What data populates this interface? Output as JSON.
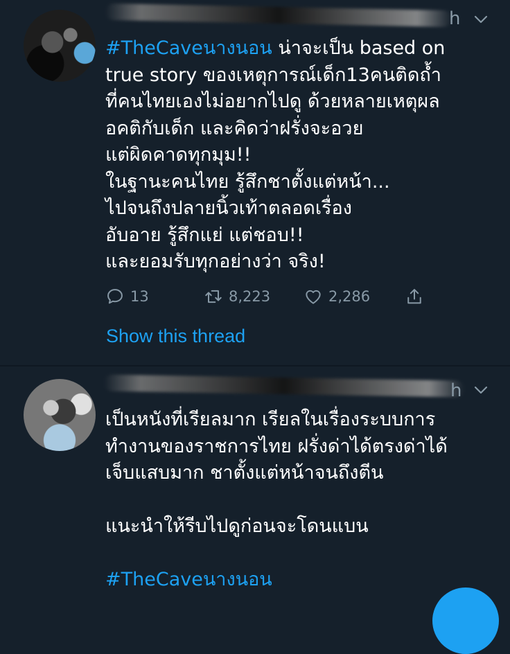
{
  "tweets": [
    {
      "time": "h",
      "lines": [
        {
          "hashtag": "#TheCaveนางนอน",
          "text": " น่าจะเป็น based on"
        },
        {
          "hashtag": "",
          "text": "true story ของเหตุการณ์เด็ก13คนติดถ้ำ"
        },
        {
          "hashtag": "",
          "text": "ที่คนไทยเองไม่อยากไปดู ด้วยหลายเหตุผล"
        },
        {
          "hashtag": "",
          "text": "อคติกับเด็ก และคิดว่าฝรั่งจะอวย"
        },
        {
          "hashtag": "",
          "text": "แต่ผิดคาดทุกมุม!!"
        },
        {
          "hashtag": "",
          "text": "ในฐานะคนไทย รู้สึกชาตั้งแต่หน้า..."
        },
        {
          "hashtag": "",
          "text": "ไปจนถึงปลายนิ้วเท้าตลอดเรื่อง"
        },
        {
          "hashtag": "",
          "text": "อับอาย รู้สึกแย่ แต่ชอบ!!"
        },
        {
          "hashtag": "",
          "text": "และยอมรับทุกอย่างว่า จริง!"
        }
      ],
      "replies": "13",
      "retweets": "8,223",
      "likes": "2,286",
      "show_thread": "Show this thread"
    },
    {
      "time": "h",
      "lines": [
        "เป็นหนังที่เรียลมาก เรียลในเรื่องระบบการ",
        "ทำงานของราชการไทย ฝรั่งด่าได้ตรงด่าได้",
        "เจ็บแสบมาก ชาตั้งแต่หน้าจนถึงตีน",
        "แนะนำให้รีบไปดูก่อนจะโดนแบน"
      ],
      "hashtag": "#TheCaveนางนอน"
    }
  ],
  "icons": {
    "reply": "comment-icon",
    "retweet": "retweet-icon",
    "like": "heart-icon",
    "share": "share-icon",
    "menu": "chevron-down-icon"
  },
  "colors": {
    "background": "#15202b",
    "accent": "#1da1f2",
    "secondary_text": "#8899a6"
  }
}
